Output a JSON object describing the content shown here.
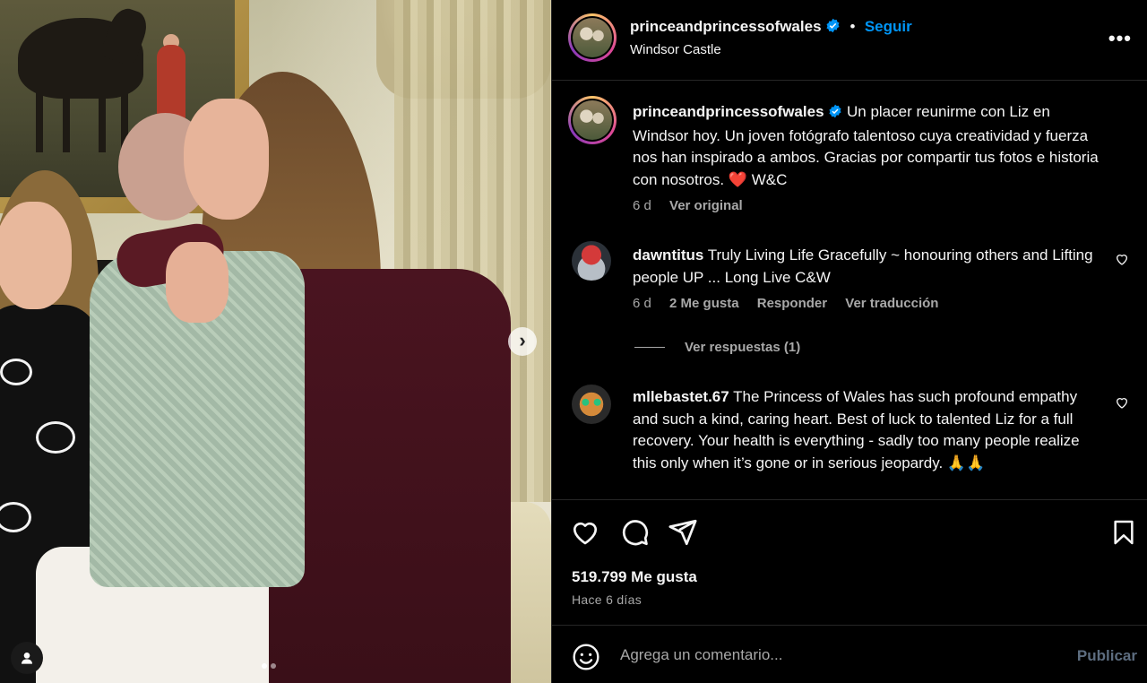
{
  "post": {
    "username": "princeandprincessofwales",
    "follow_label": "Seguir",
    "separator": "•",
    "location": "Windsor Castle",
    "more_label": "•••"
  },
  "caption": {
    "username": "princeandprincessofwales",
    "text": "Un placer reunirme con Liz en Windsor hoy. Un joven fotógrafo talentoso cuya creatividad y fuerza nos han inspirado a ambos. Gracias por compartir tus fotos e historia con nosotros.",
    "emoji": "❤️",
    "signature": "W&C",
    "age": "6 d",
    "see_original": "Ver original"
  },
  "comments": [
    {
      "username": "dawntitus",
      "text": "Truly Living Life Gracefully ~ honouring others and Lifting people UP ... Long Live C&W",
      "age": "6 d",
      "likes": "2 Me gusta",
      "reply": "Responder",
      "translate": "Ver traducción",
      "view_replies": "Ver respuestas (1)"
    },
    {
      "username": "mllebastet.67",
      "text": "The Princess of Wales has such profound empathy and such a kind, caring heart. Best of luck to talented Liz for a full recovery. Your health is everything - sadly too many people realize this only when it’s gone or in serious jeopardy. 🙏🙏"
    }
  ],
  "stats": {
    "likes": "519.799 Me gusta",
    "time": "Hace 6 días"
  },
  "composer": {
    "placeholder": "Agrega un comentario...",
    "publish": "Publicar"
  },
  "carousel": {
    "next_label": "›"
  },
  "colors": {
    "background": "#000000",
    "text": "#f5f5f5",
    "secondary_text": "#a8a8a8",
    "link_blue": "#0095f6",
    "heart_red": "#ff3040",
    "divider": "#262626",
    "publish_disabled": "#5d6d80"
  },
  "icons": [
    "verified-badge-icon",
    "more-options-icon",
    "like-heart-icon",
    "comment-icon",
    "share-icon",
    "save-bookmark-icon",
    "emoji-icon",
    "carousel-next-icon",
    "user-tag-icon"
  ]
}
